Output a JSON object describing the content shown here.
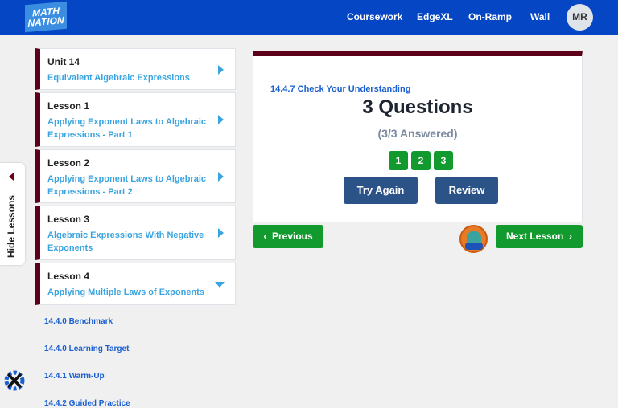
{
  "header": {
    "logo": "MATH NATION",
    "nav": [
      "Coursework",
      "EdgeXL",
      "On-Ramp",
      "Wall"
    ],
    "avatar": "MR"
  },
  "sidebar": {
    "hide_label": "Hide Lessons",
    "cards": [
      {
        "title": "Unit 14",
        "subtitle": "Equivalent Algebraic Expressions"
      },
      {
        "title": "Lesson 1",
        "subtitle": "Applying Exponent Laws to Algebraic Expressions - Part 1"
      },
      {
        "title": "Lesson 2",
        "subtitle": "Applying Exponent Laws to Algebraic Expressions - Part 2"
      },
      {
        "title": "Lesson 3",
        "subtitle": "Algebraic Expressions With Negative Exponents"
      },
      {
        "title": "Lesson 4",
        "subtitle": "Applying Multiple Laws of Exponents"
      }
    ],
    "sections": [
      "14.4.0 Benchmark",
      "14.4.0 Learning Target",
      "14.4.1 Warm-Up",
      "14.4.2 Guided Practice"
    ]
  },
  "main": {
    "section": "14.4.7 Check Your Understanding",
    "title": "3 Questions",
    "status": "(3/3 Answered)",
    "questions": [
      "1",
      "2",
      "3"
    ],
    "try_again": "Try Again",
    "review": "Review",
    "previous": "Previous",
    "next": "Next Lesson"
  }
}
